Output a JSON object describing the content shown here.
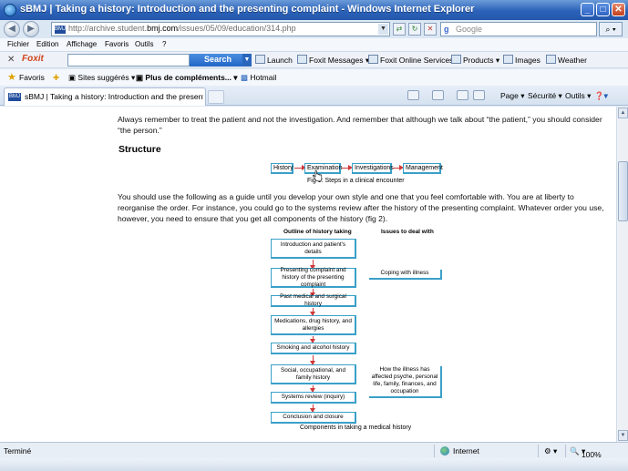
{
  "window": {
    "title": "sBMJ | Taking a history: Introduction and the presenting complaint - Windows Internet Explorer",
    "minimize": "_",
    "maximize": "□",
    "close": "✕"
  },
  "address": {
    "url_prefix": "http://archive.student.",
    "url_domain": "bmj.com",
    "url_rest": "/issues/05/09/education/314.php",
    "favicon_text": "BMJ",
    "search_placeholder": "Google"
  },
  "menu": [
    "Fichier",
    "Edition",
    "Affichage",
    "Favoris",
    "Outils",
    "?"
  ],
  "foxit_toolbar": {
    "brand": "Foxit",
    "search_label": "Search",
    "items": [
      "Launch",
      "Foxit Messages",
      "Foxit Online Services",
      "Products",
      "Images",
      "Weather"
    ]
  },
  "favorites_bar": {
    "favorites_label": "Favoris",
    "items": [
      "Sites suggérés",
      "Plus de compléments...",
      "Hotmail"
    ]
  },
  "tabs": {
    "active_label": "sBMJ | Taking a history: Introduction and the presenti...",
    "commands": [
      "Page",
      "Sécurité",
      "Outils"
    ]
  },
  "content": {
    "para1": "Always remember to treat the patient and not the investigation. And remember that although we talk about “the patient,” you should consider “the person.”",
    "heading": "Structure",
    "para2": "You should use the following as a guide until you develop your own style and one that you feel comfortable with. You are at liberty to reorganise the order. For instance, you could go to the systems review after the history of the presenting complaint. Whatever order you use, however, you need to ensure that you get all components of the history (fig 2).",
    "fig1": {
      "steps": [
        "History",
        "Examination",
        "Investigations",
        "Management"
      ],
      "caption": "Fig 1: Steps in a clinical encounter"
    },
    "fig2": {
      "col_left_header": "Outline of history taking",
      "col_right_header": "Issues to deal with",
      "steps": [
        "Introduction and patient's details",
        "Presenting complaint and history of the presenting complaint",
        "Past medical and surgical history",
        "Medications, drug history, and allergies",
        "Smoking and alcohol history",
        "Social, occupational, and family history",
        "Systems review (inquiry)",
        "Conclusion and closure"
      ],
      "issues": [
        "Coping with illness",
        "How the illness has affected psyche, personal life, family, finances, and occupation"
      ],
      "caption": "Components in taking a medical history"
    }
  },
  "status": {
    "left": "Terminé",
    "zone": "Internet",
    "zoom": "100%"
  },
  "colors": {
    "titlebar": "#2b62b8",
    "box_border": "#3aa0c8",
    "arrow": "#d23838"
  }
}
